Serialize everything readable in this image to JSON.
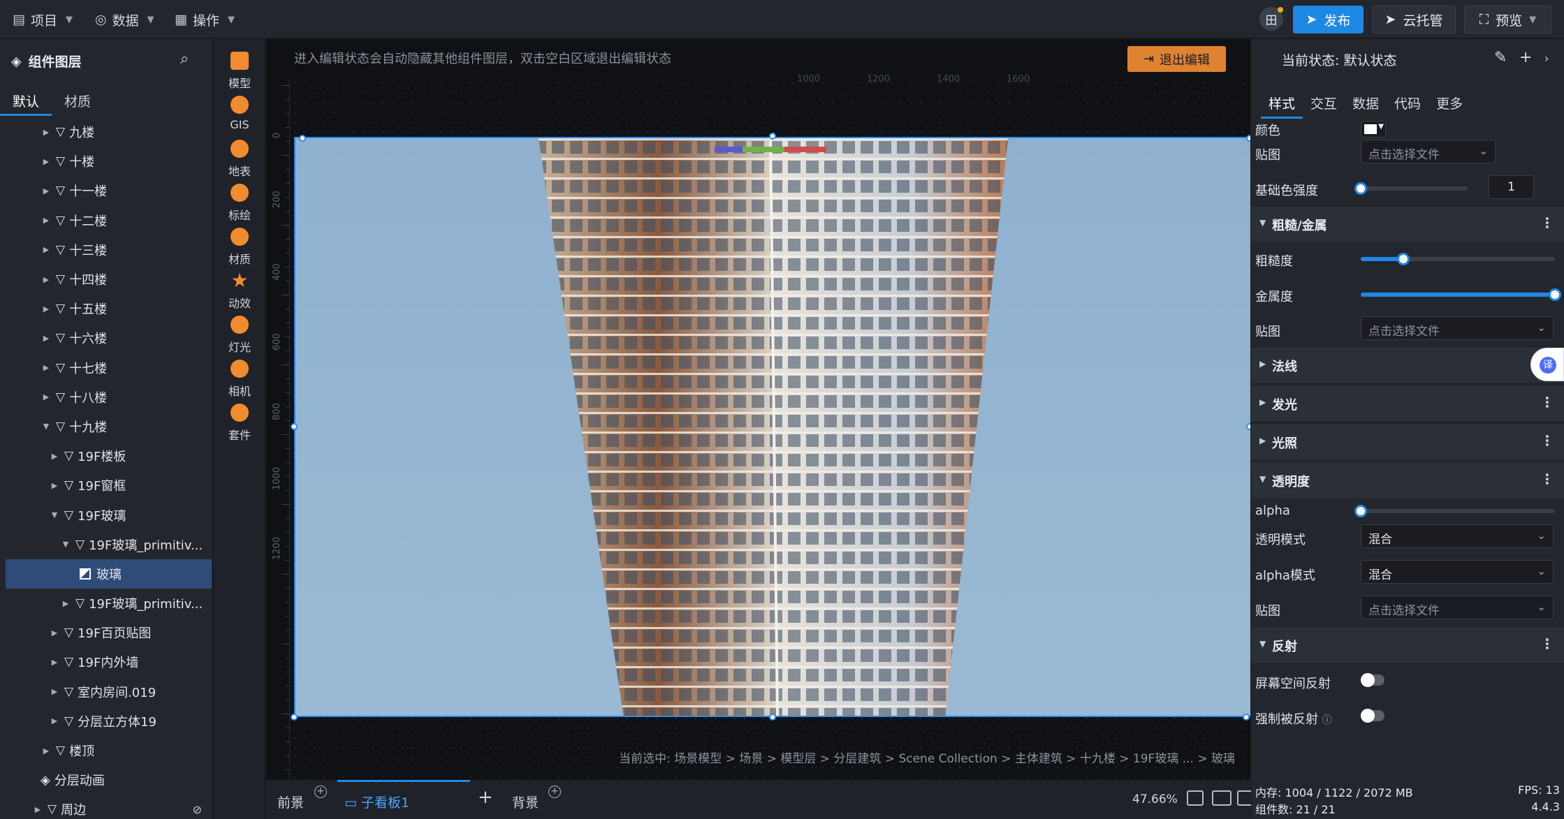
{
  "topbar": {
    "menus": [
      {
        "label": "项目",
        "icon": "file-icon"
      },
      {
        "label": "数据",
        "icon": "database-icon"
      },
      {
        "label": "操作",
        "icon": "grid-icon"
      }
    ],
    "avatar_label": "田",
    "publish_label": "发布",
    "cloud_label": "云托管",
    "preview_label": "预览"
  },
  "left_panel": {
    "title": "组件图层",
    "tabs": [
      "默认",
      "材质"
    ],
    "tree": [
      {
        "label": "九楼",
        "level": 1,
        "expanded": false
      },
      {
        "label": "十楼",
        "level": 1,
        "expanded": false
      },
      {
        "label": "十一楼",
        "level": 1,
        "expanded": false
      },
      {
        "label": "十二楼",
        "level": 1,
        "expanded": false
      },
      {
        "label": "十三楼",
        "level": 1,
        "expanded": false
      },
      {
        "label": "十四楼",
        "level": 1,
        "expanded": false
      },
      {
        "label": "十五楼",
        "level": 1,
        "expanded": false
      },
      {
        "label": "十六楼",
        "level": 1,
        "expanded": false
      },
      {
        "label": "十七楼",
        "level": 1,
        "expanded": false
      },
      {
        "label": "十八楼",
        "level": 1,
        "expanded": false
      },
      {
        "label": "十九楼",
        "level": 1,
        "expanded": true
      },
      {
        "label": "19F楼板",
        "level": 2,
        "expanded": false
      },
      {
        "label": "19F窗框",
        "level": 2,
        "expanded": false
      },
      {
        "label": "19F玻璃",
        "level": 2,
        "expanded": true
      },
      {
        "label": "19F玻璃_primitiv...",
        "level": 3,
        "expanded": true
      },
      {
        "label": "玻璃",
        "level": 4,
        "selected": true,
        "material": true
      },
      {
        "label": "19F玻璃_primitiv...",
        "level": 3,
        "expanded": false
      },
      {
        "label": "19F百页贴图",
        "level": 2,
        "expanded": false
      },
      {
        "label": "19F内外墙",
        "level": 2,
        "expanded": false
      },
      {
        "label": "室内房间.019",
        "level": 2,
        "expanded": false
      },
      {
        "label": "分层立方体19",
        "level": 2,
        "expanded": false
      },
      {
        "label": "楼顶",
        "level": 1,
        "expanded": false
      },
      {
        "label": "分层动画",
        "level": 1,
        "animation": true
      },
      {
        "label": "周边",
        "level": 0,
        "expanded": false,
        "hidden": true
      }
    ]
  },
  "tools": [
    {
      "label": "模型",
      "icon": "model-icon"
    },
    {
      "label": "GIS",
      "icon": "globe-icon"
    },
    {
      "label": "地表",
      "icon": "terrain-icon"
    },
    {
      "label": "标绘",
      "icon": "pin-icon"
    },
    {
      "label": "材质",
      "icon": "material-icon"
    },
    {
      "label": "动效",
      "icon": "effect-icon"
    },
    {
      "label": "灯光",
      "icon": "light-icon"
    },
    {
      "label": "相机",
      "icon": "camera-icon"
    },
    {
      "label": "套件",
      "icon": "kit-icon"
    }
  ],
  "canvas": {
    "hint": "进入编辑状态会自动隐藏其他组件图层，双击空白区域退出编辑状态",
    "exit_label": "退出编辑",
    "ruler_top": [
      "1000",
      "1200",
      "1400",
      "1600"
    ],
    "ruler_left": [
      "0",
      "200",
      "400",
      "600",
      "800",
      "1000",
      "1200"
    ],
    "breadcrumb": "当前选中: 场景模型 > 场景 > 模型层 > 分层建筑 > Scene Collection > 主体建筑 > 十九楼 > 19F玻璃 ... > 玻璃"
  },
  "bottombar": {
    "tabs": [
      "前景",
      "子看板1",
      "背景"
    ],
    "active_tab": "子看板1",
    "zoom": "47.66%"
  },
  "right_panel": {
    "status": "当前状态: 默认状态",
    "tabs": [
      "样式",
      "交互",
      "数据",
      "代码",
      "更多"
    ],
    "color_label": "颜色",
    "color_value": "#ffffff",
    "map_label": "贴图",
    "file_placeholder": "点击选择文件",
    "base_strength_label": "基础色强度",
    "base_strength_value": "1",
    "base_strength": 0,
    "sections": {
      "rough": "粗糙/金属",
      "normal": "法线",
      "emissive": "发光",
      "lighting": "光照",
      "transparency": "透明度",
      "reflection": "反射"
    },
    "roughness_label": "粗糙度",
    "roughness": 0.22,
    "metalness_label": "金属度",
    "metalness": 1.0,
    "alpha_label": "alpha",
    "alpha": 0,
    "transparent_mode_label": "透明模式",
    "transparent_mode_value": "混合",
    "alpha_mode_label": "alpha模式",
    "alpha_mode_value": "混合",
    "ssr_label": "屏幕空间反射",
    "force_reflect_label": "强制被反射",
    "footer": {
      "memory": "内存: 1004 / 1122 / 2072 MB",
      "fps": "FPS: 13",
      "components": "组件数: 21 / 21",
      "version": "4.4.3"
    }
  }
}
